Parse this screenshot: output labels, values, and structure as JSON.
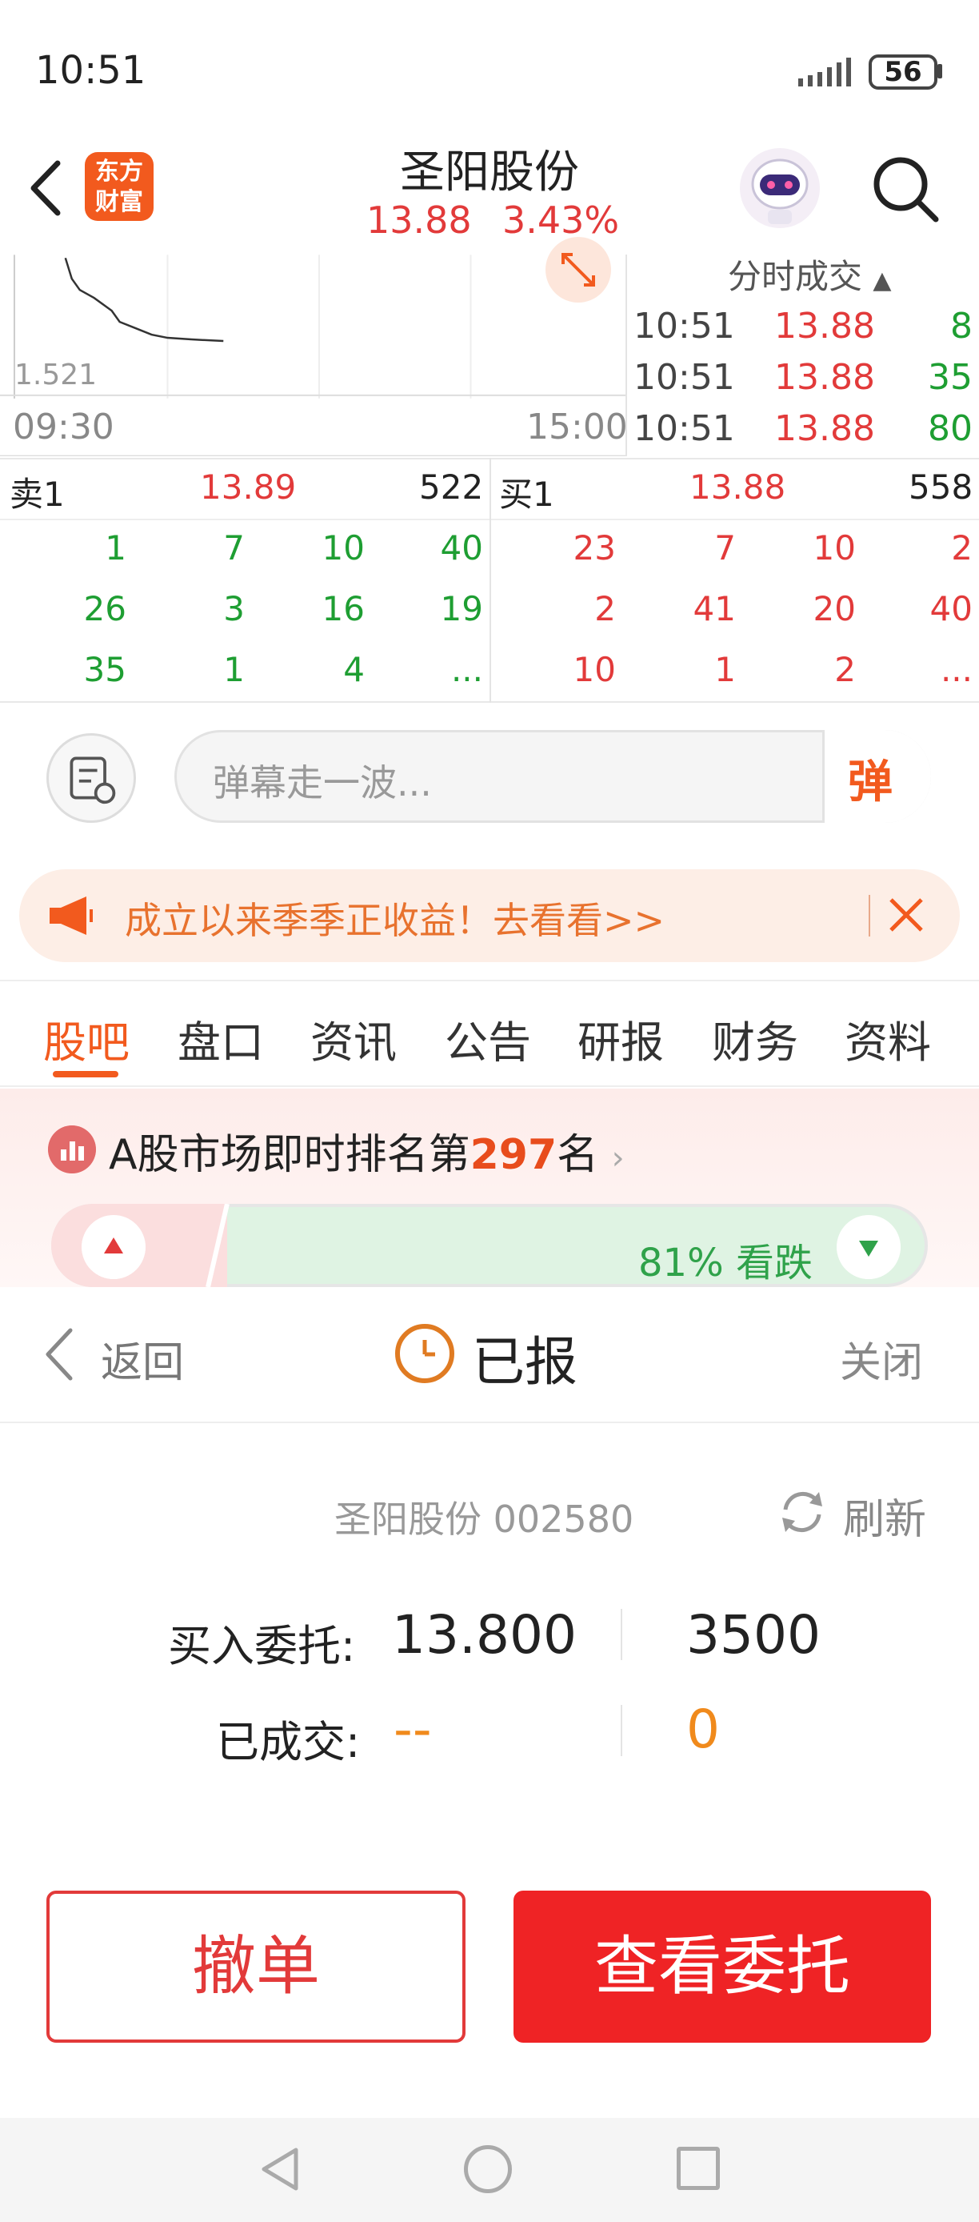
{
  "status_bar": {
    "time": "10:51",
    "battery": "56"
  },
  "header": {
    "logo_line1": "东方",
    "logo_line2": "财富",
    "stock_name": "圣阳股份",
    "price": "13.88",
    "change_pct": "3.43%"
  },
  "chart": {
    "low_label": "1.521",
    "time_start": "09:30",
    "time_end": "15:00"
  },
  "ticks": {
    "title": "分时成交",
    "rows": [
      {
        "time": "10:51",
        "price": "13.88",
        "vol": "8"
      },
      {
        "time": "10:51",
        "price": "13.88",
        "vol": "35"
      },
      {
        "time": "10:51",
        "price": "13.88",
        "vol": "80"
      }
    ]
  },
  "order_book": {
    "sell_label": "卖1",
    "sell_price": "13.89",
    "sell_vol": "522",
    "buy_label": "买1",
    "buy_price": "13.88",
    "buy_vol": "558",
    "sell_queue": [
      [
        "1",
        "7",
        "10",
        "40"
      ],
      [
        "26",
        "3",
        "16",
        "19"
      ],
      [
        "35",
        "1",
        "4",
        "..."
      ]
    ],
    "buy_queue": [
      [
        "23",
        "7",
        "10",
        "2"
      ],
      [
        "2",
        "41",
        "20",
        "40"
      ],
      [
        "10",
        "1",
        "2",
        "..."
      ]
    ]
  },
  "danmu": {
    "placeholder": "弹幕走一波...",
    "button": "弹"
  },
  "banner": {
    "text": "成立以来季季正收益！去看看>>"
  },
  "tabs": [
    "股吧",
    "盘口",
    "资讯",
    "公告",
    "研报",
    "财务",
    "资料"
  ],
  "ranking": {
    "prefix": "A股市场即时排名第",
    "rank": "297",
    "suffix": "名"
  },
  "sentiment": {
    "text": "81% 看跌",
    "down_pct": 81
  },
  "sheet": {
    "back": "返回",
    "status": "已报",
    "close": "关闭",
    "stock": "圣阳股份 002580",
    "refresh": "刷新",
    "buy_label": "买入委托:",
    "buy_price": "13.800",
    "buy_qty": "3500",
    "done_label": "已成交:",
    "done_price": "--",
    "done_qty": "0",
    "cancel_btn": "撤单",
    "view_btn": "查看委托"
  },
  "colors": {
    "up": "#e23a3a",
    "down": "#1e9e32",
    "accent": "#f25a1e"
  }
}
